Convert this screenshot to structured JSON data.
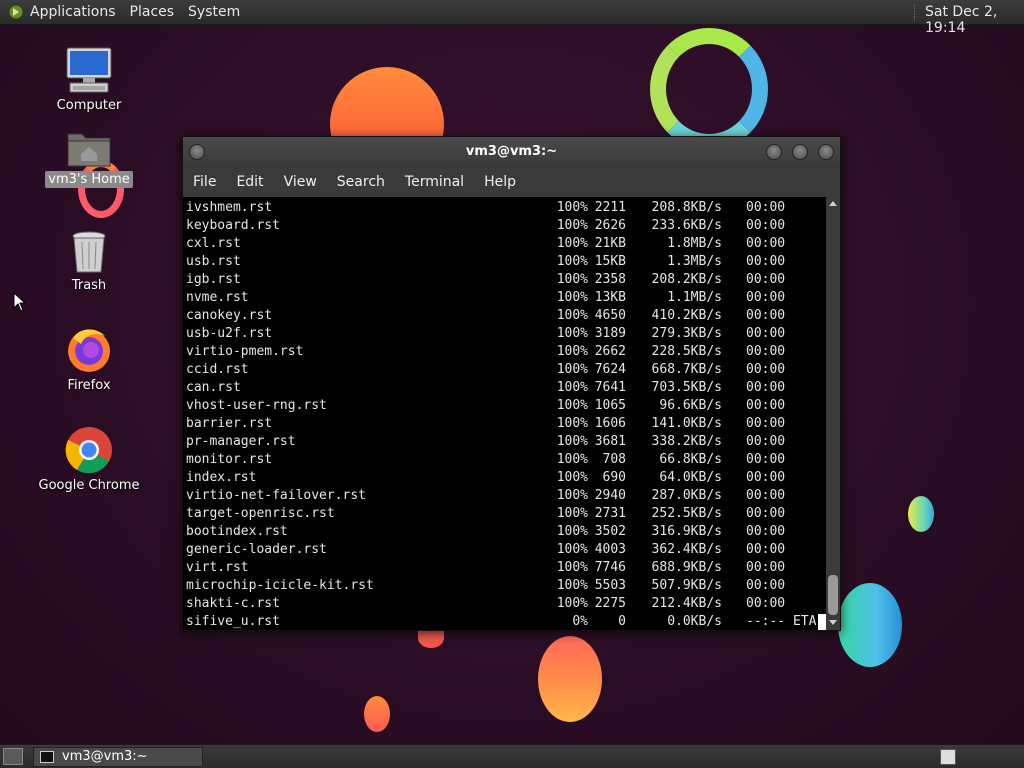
{
  "top_panel": {
    "menus": [
      "Applications",
      "Places",
      "System"
    ],
    "clock": "Sat Dec  2, 19:14"
  },
  "desktop": {
    "icons": [
      {
        "label": "Computer",
        "icon": "computer-icon"
      },
      {
        "label": "vm3's Home",
        "icon": "home-folder-icon",
        "selected": true
      },
      {
        "label": "Trash",
        "icon": "trash-icon"
      },
      {
        "label": "Firefox",
        "icon": "firefox-icon"
      },
      {
        "label": "Google Chrome",
        "icon": "chrome-icon"
      }
    ]
  },
  "terminal": {
    "title": "vm3@vm3:~",
    "menus": [
      "File",
      "Edit",
      "View",
      "Search",
      "Terminal",
      "Help"
    ],
    "rows": [
      {
        "name": "ivshmem.rst",
        "pct": "100%",
        "size": "2211",
        "rate": "208.8KB/s",
        "time": "00:00"
      },
      {
        "name": "keyboard.rst",
        "pct": "100%",
        "size": "2626",
        "rate": "233.6KB/s",
        "time": "00:00"
      },
      {
        "name": "cxl.rst",
        "pct": "100%",
        "size": "21KB",
        "rate": "1.8MB/s",
        "time": "00:00"
      },
      {
        "name": "usb.rst",
        "pct": "100%",
        "size": "15KB",
        "rate": "1.3MB/s",
        "time": "00:00"
      },
      {
        "name": "igb.rst",
        "pct": "100%",
        "size": "2358",
        "rate": "208.2KB/s",
        "time": "00:00"
      },
      {
        "name": "nvme.rst",
        "pct": "100%",
        "size": "13KB",
        "rate": "1.1MB/s",
        "time": "00:00"
      },
      {
        "name": "canokey.rst",
        "pct": "100%",
        "size": "4650",
        "rate": "410.2KB/s",
        "time": "00:00"
      },
      {
        "name": "usb-u2f.rst",
        "pct": "100%",
        "size": "3189",
        "rate": "279.3KB/s",
        "time": "00:00"
      },
      {
        "name": "virtio-pmem.rst",
        "pct": "100%",
        "size": "2662",
        "rate": "228.5KB/s",
        "time": "00:00"
      },
      {
        "name": "ccid.rst",
        "pct": "100%",
        "size": "7624",
        "rate": "668.7KB/s",
        "time": "00:00"
      },
      {
        "name": "can.rst",
        "pct": "100%",
        "size": "7641",
        "rate": "703.5KB/s",
        "time": "00:00"
      },
      {
        "name": "vhost-user-rng.rst",
        "pct": "100%",
        "size": "1065",
        "rate": "96.6KB/s",
        "time": "00:00"
      },
      {
        "name": "barrier.rst",
        "pct": "100%",
        "size": "1606",
        "rate": "141.0KB/s",
        "time": "00:00"
      },
      {
        "name": "pr-manager.rst",
        "pct": "100%",
        "size": "3681",
        "rate": "338.2KB/s",
        "time": "00:00"
      },
      {
        "name": "monitor.rst",
        "pct": "100%",
        "size": "708",
        "rate": "66.8KB/s",
        "time": "00:00"
      },
      {
        "name": "index.rst",
        "pct": "100%",
        "size": "690",
        "rate": "64.0KB/s",
        "time": "00:00"
      },
      {
        "name": "virtio-net-failover.rst",
        "pct": "100%",
        "size": "2940",
        "rate": "287.0KB/s",
        "time": "00:00"
      },
      {
        "name": "target-openrisc.rst",
        "pct": "100%",
        "size": "2731",
        "rate": "252.5KB/s",
        "time": "00:00"
      },
      {
        "name": "bootindex.rst",
        "pct": "100%",
        "size": "3502",
        "rate": "316.9KB/s",
        "time": "00:00"
      },
      {
        "name": "generic-loader.rst",
        "pct": "100%",
        "size": "4003",
        "rate": "362.4KB/s",
        "time": "00:00"
      },
      {
        "name": "virt.rst",
        "pct": "100%",
        "size": "7746",
        "rate": "688.9KB/s",
        "time": "00:00"
      },
      {
        "name": "microchip-icicle-kit.rst",
        "pct": "100%",
        "size": "5503",
        "rate": "507.9KB/s",
        "time": "00:00"
      },
      {
        "name": "shakti-c.rst",
        "pct": "100%",
        "size": "2275",
        "rate": "212.4KB/s",
        "time": "00:00"
      },
      {
        "name": "sifive_u.rst",
        "pct": "0%",
        "size": "0",
        "rate": "0.0KB/s",
        "time": "--:-- ETA"
      }
    ]
  },
  "taskbar": {
    "task_label": "vm3@vm3:~"
  }
}
